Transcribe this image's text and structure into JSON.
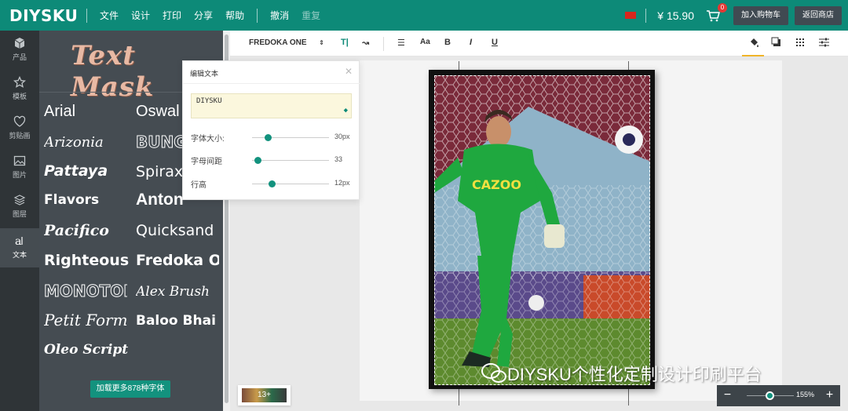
{
  "app": {
    "logo": "DIYSKU",
    "menu": [
      "文件",
      "设计",
      "打印",
      "分享",
      "帮助"
    ],
    "undo": "撤消",
    "redo": "重复",
    "price": "¥ 15.90",
    "cart_count": "0",
    "add_to_cart": "加入购物车",
    "back_to_store": "返回商店"
  },
  "leftnav": [
    {
      "label": "产品",
      "icon": "cube-icon"
    },
    {
      "label": "模板",
      "icon": "star-icon"
    },
    {
      "label": "剪贴画",
      "icon": "heart-icon"
    },
    {
      "label": "图片",
      "icon": "image-icon"
    },
    {
      "label": "图层",
      "icon": "layers-icon"
    },
    {
      "label": "文本",
      "icon": "text-icon",
      "active": true
    }
  ],
  "fontpanel": {
    "banner": "Text Mask",
    "fonts": [
      "Arial",
      "Oswald",
      "Arizonia",
      "BUNG",
      "Pattaya",
      "Spirax",
      "Flavors",
      "Anton",
      "Pacifico",
      "Quicksand",
      "Righteous",
      "Fredoka On",
      "MONOTON",
      "Alex Brush",
      "Petit Form",
      "Baloo Bhai",
      "Oleo Script S"
    ],
    "more_button": "加载更多878种字体"
  },
  "toolbar": {
    "font_name": "FREDOKA ONE",
    "bold": "B",
    "italic": "I",
    "underline": "U"
  },
  "edit_popup": {
    "title": "编辑文本",
    "text_value": "DIYSKU",
    "sliders": [
      {
        "label": "字体大小:",
        "value": "30px",
        "level": 0.2
      },
      {
        "label": "字母间距",
        "value": "33",
        "level": 0.07
      },
      {
        "label": "行高",
        "value": "12px",
        "level": 0.25
      }
    ]
  },
  "thumbnail_label": "13+",
  "zoom": {
    "value": "155%",
    "minus": "−",
    "plus": "+"
  },
  "watermark": "DIYSKU个性化定制设计印刷平台",
  "colors": {
    "brand": "#0d8a78",
    "accent": "#13927e"
  }
}
